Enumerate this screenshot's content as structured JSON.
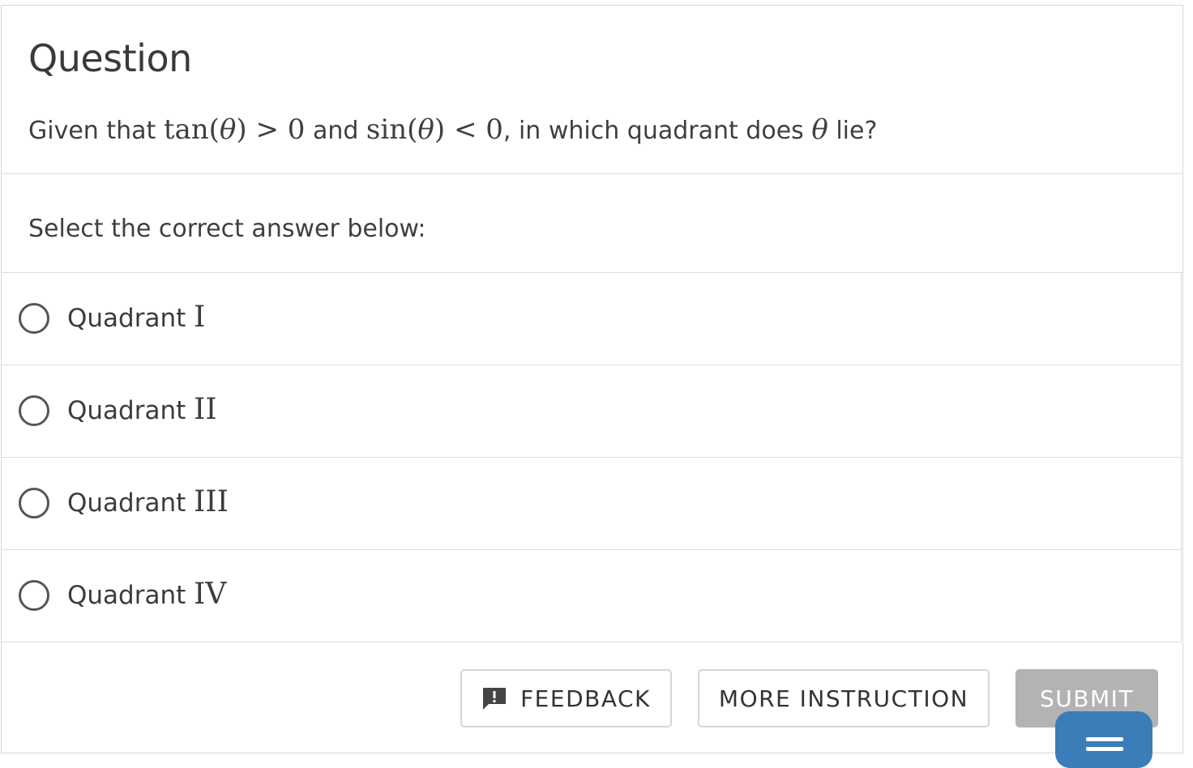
{
  "question": {
    "title": "Question",
    "prefix": "Given that ",
    "tan_fn": "tan(",
    "theta": "θ",
    "close_gt": ") > 0",
    "and": " and ",
    "sin_fn": "sin(",
    "close_lt": ") < 0",
    "suffix_a": ", in which quadrant does ",
    "suffix_b": " lie?"
  },
  "answer_prompt": "Select the correct answer below:",
  "options": [
    {
      "text": "Quadrant ",
      "numeral": "I"
    },
    {
      "text": "Quadrant ",
      "numeral": "II"
    },
    {
      "text": "Quadrant ",
      "numeral": "III"
    },
    {
      "text": "Quadrant ",
      "numeral": "IV"
    }
  ],
  "buttons": {
    "feedback": "FEEDBACK",
    "more_instruction": "MORE INSTRUCTION",
    "submit": "SUBMIT"
  },
  "icons": {
    "feedback": "feedback-exclamation-icon",
    "chat": "chat-menu-icon",
    "radio": "radio-unchecked-icon"
  },
  "colors": {
    "submit_bg": "#b3b3b3",
    "chat_bg": "#3a7db8",
    "border": "#dcdcdc"
  }
}
